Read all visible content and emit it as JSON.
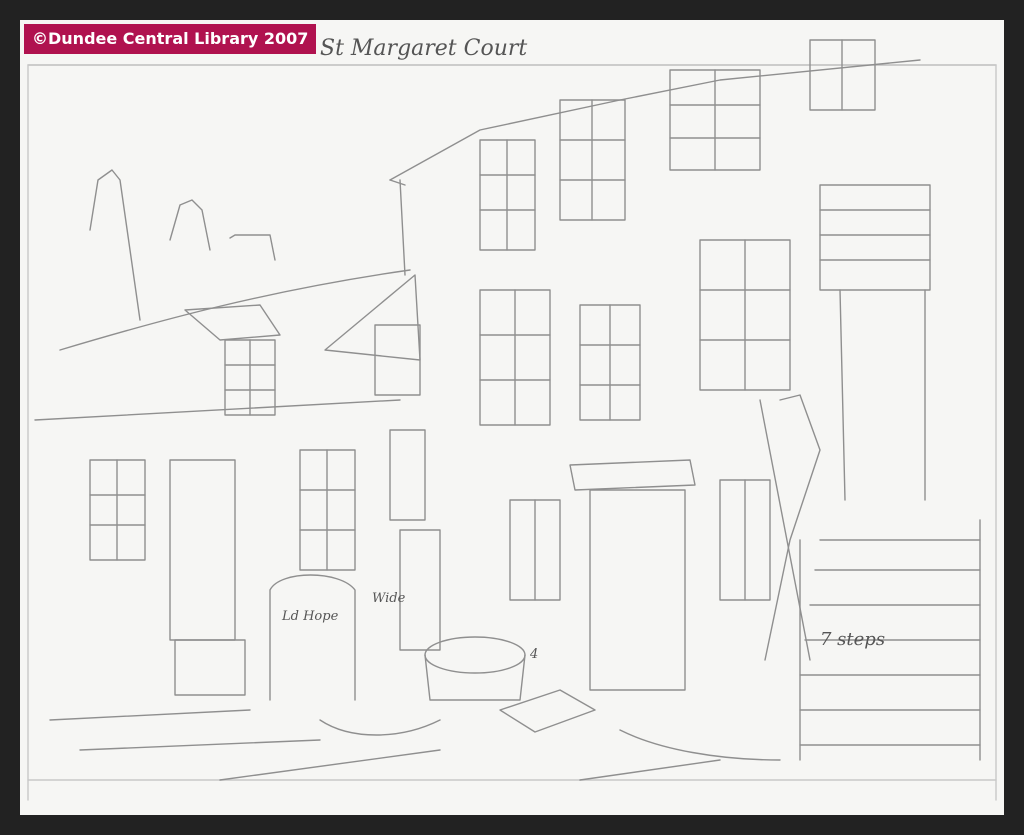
{
  "copyright": {
    "text": "©Dundee Central Library 2007"
  },
  "annotations": {
    "title": "St Margaret Court",
    "left_door": "Ld Hope",
    "wide": "Wide",
    "four": "4",
    "seven_steps": "7 steps"
  },
  "colors": {
    "badge": "#b0124f",
    "paper": "#f6f6f4",
    "pencil": "#8a8a8a",
    "border": "#222222"
  }
}
